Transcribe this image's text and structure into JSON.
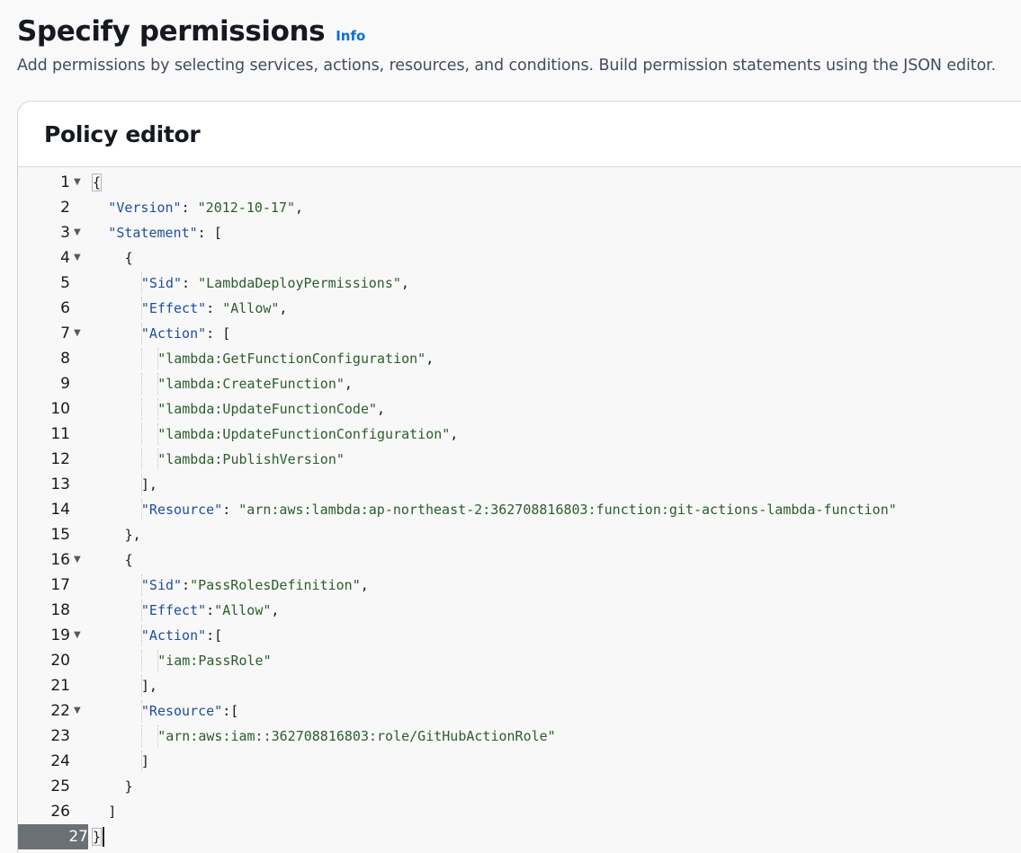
{
  "header": {
    "title": "Specify permissions",
    "info_label": "Info",
    "description": "Add permissions by selecting services, actions, resources, and conditions. Build permission statements using the JSON editor."
  },
  "editor": {
    "title": "Policy editor",
    "active_line": 27,
    "lines": [
      {
        "num": "1",
        "fold": true,
        "indent": 0,
        "tokens": [
          [
            "p",
            "{"
          ]
        ]
      },
      {
        "num": "2",
        "fold": false,
        "indent": 1,
        "tokens": [
          [
            "k",
            "\"Version\""
          ],
          [
            "p",
            ": "
          ],
          [
            "s",
            "\"2012-10-17\""
          ],
          [
            "p",
            ","
          ]
        ]
      },
      {
        "num": "3",
        "fold": true,
        "indent": 1,
        "tokens": [
          [
            "k",
            "\"Statement\""
          ],
          [
            "p",
            ": ["
          ]
        ]
      },
      {
        "num": "4",
        "fold": true,
        "indent": 2,
        "tokens": [
          [
            "p",
            "{"
          ]
        ]
      },
      {
        "num": "5",
        "fold": false,
        "indent": 3,
        "tokens": [
          [
            "k",
            "\"Sid\""
          ],
          [
            "p",
            ": "
          ],
          [
            "s",
            "\"LambdaDeployPermissions\""
          ],
          [
            "p",
            ","
          ]
        ]
      },
      {
        "num": "6",
        "fold": false,
        "indent": 3,
        "tokens": [
          [
            "k",
            "\"Effect\""
          ],
          [
            "p",
            ": "
          ],
          [
            "s",
            "\"Allow\""
          ],
          [
            "p",
            ","
          ]
        ]
      },
      {
        "num": "7",
        "fold": true,
        "indent": 3,
        "tokens": [
          [
            "k",
            "\"Action\""
          ],
          [
            "p",
            ": ["
          ]
        ]
      },
      {
        "num": "8",
        "fold": false,
        "indent": 4,
        "tokens": [
          [
            "s",
            "\"lambda:GetFunctionConfiguration\""
          ],
          [
            "p",
            ","
          ]
        ]
      },
      {
        "num": "9",
        "fold": false,
        "indent": 4,
        "tokens": [
          [
            "s",
            "\"lambda:CreateFunction\""
          ],
          [
            "p",
            ","
          ]
        ]
      },
      {
        "num": "10",
        "fold": false,
        "indent": 4,
        "tokens": [
          [
            "s",
            "\"lambda:UpdateFunctionCode\""
          ],
          [
            "p",
            ","
          ]
        ]
      },
      {
        "num": "11",
        "fold": false,
        "indent": 4,
        "tokens": [
          [
            "s",
            "\"lambda:UpdateFunctionConfiguration\""
          ],
          [
            "p",
            ","
          ]
        ]
      },
      {
        "num": "12",
        "fold": false,
        "indent": 4,
        "tokens": [
          [
            "s",
            "\"lambda:PublishVersion\""
          ]
        ]
      },
      {
        "num": "13",
        "fold": false,
        "indent": 3,
        "tokens": [
          [
            "p",
            "],"
          ]
        ]
      },
      {
        "num": "14",
        "fold": false,
        "indent": 3,
        "tokens": [
          [
            "k",
            "\"Resource\""
          ],
          [
            "p",
            ": "
          ],
          [
            "s",
            "\"arn:aws:lambda:ap-northeast-2:362708816803:function:git-actions-lambda-function\""
          ]
        ]
      },
      {
        "num": "15",
        "fold": false,
        "indent": 2,
        "tokens": [
          [
            "p",
            "},"
          ]
        ]
      },
      {
        "num": "16",
        "fold": true,
        "indent": 2,
        "tokens": [
          [
            "p",
            "{"
          ]
        ]
      },
      {
        "num": "17",
        "fold": false,
        "indent": 3,
        "tokens": [
          [
            "k",
            "\"Sid\""
          ],
          [
            "p",
            ":"
          ],
          [
            "s",
            "\"PassRolesDefinition\""
          ],
          [
            "p",
            ","
          ]
        ]
      },
      {
        "num": "18",
        "fold": false,
        "indent": 3,
        "tokens": [
          [
            "k",
            "\"Effect\""
          ],
          [
            "p",
            ":"
          ],
          [
            "s",
            "\"Allow\""
          ],
          [
            "p",
            ","
          ]
        ]
      },
      {
        "num": "19",
        "fold": true,
        "indent": 3,
        "tokens": [
          [
            "k",
            "\"Action\""
          ],
          [
            "p",
            ":["
          ]
        ]
      },
      {
        "num": "20",
        "fold": false,
        "indent": 4,
        "tokens": [
          [
            "s",
            "\"iam:PassRole\""
          ]
        ]
      },
      {
        "num": "21",
        "fold": false,
        "indent": 3,
        "tokens": [
          [
            "p",
            "],"
          ]
        ]
      },
      {
        "num": "22",
        "fold": true,
        "indent": 3,
        "tokens": [
          [
            "k",
            "\"Resource\""
          ],
          [
            "p",
            ":["
          ]
        ]
      },
      {
        "num": "23",
        "fold": false,
        "indent": 4,
        "tokens": [
          [
            "s",
            "\"arn:aws:iam::362708816803:role/GitHubActionRole\""
          ]
        ]
      },
      {
        "num": "24",
        "fold": false,
        "indent": 3,
        "tokens": [
          [
            "p",
            "]"
          ]
        ]
      },
      {
        "num": "25",
        "fold": false,
        "indent": 2,
        "tokens": [
          [
            "p",
            "}"
          ]
        ]
      },
      {
        "num": "26",
        "fold": false,
        "indent": 1,
        "tokens": [
          [
            "p",
            "]"
          ]
        ]
      },
      {
        "num": "27",
        "fold": false,
        "indent": 0,
        "tokens": [
          [
            "p",
            "}"
          ]
        ]
      }
    ]
  }
}
